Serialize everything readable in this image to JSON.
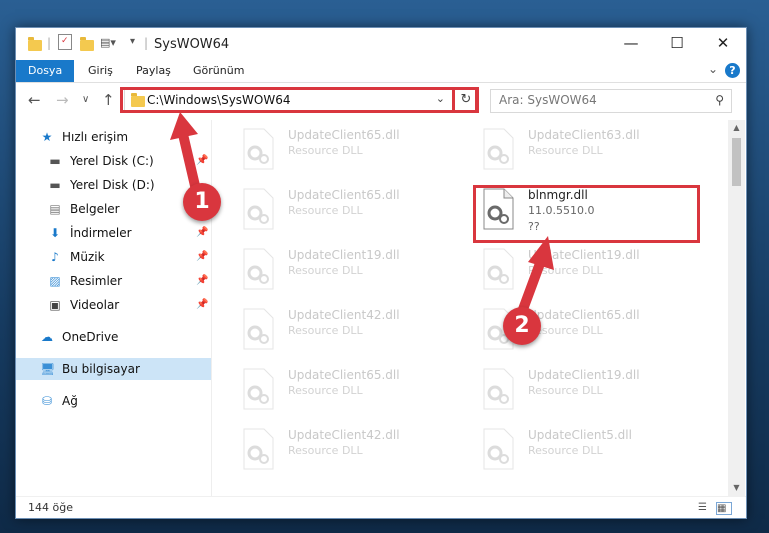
{
  "window": {
    "title": "SysWOW64",
    "controls": {
      "minimize": "—",
      "maximize": "☐",
      "close": "✕"
    }
  },
  "ribbon": {
    "tabs": [
      {
        "label": "Dosya",
        "active": true
      },
      {
        "label": "Giriş",
        "active": false
      },
      {
        "label": "Paylaş",
        "active": false
      },
      {
        "label": "Görünüm",
        "active": false
      }
    ],
    "help": "?"
  },
  "nav": {
    "address": "C:\\Windows\\SysWOW64",
    "search_placeholder": "Ara: SysWOW64"
  },
  "sidebar": {
    "quick_access": "Hızlı erişim",
    "items": [
      {
        "label": "Yerel Disk (C:)",
        "icon": "drive-icon",
        "pinned": true
      },
      {
        "label": "Yerel Disk (D:)",
        "icon": "drive-icon",
        "pinned": true
      },
      {
        "label": "Belgeler",
        "icon": "documents-icon",
        "pinned": true
      },
      {
        "label": "İndirmeler",
        "icon": "downloads-icon",
        "pinned": true
      },
      {
        "label": "Müzik",
        "icon": "music-icon",
        "pinned": true
      },
      {
        "label": "Resimler",
        "icon": "pictures-icon",
        "pinned": true
      },
      {
        "label": "Videolar",
        "icon": "videos-icon",
        "pinned": true
      }
    ],
    "onedrive": "OneDrive",
    "this_pc": "Bu bilgisayar",
    "network": "Ağ"
  },
  "files": {
    "left": [
      {
        "name": "UpdateClient65.dll",
        "desc": "Resource DLL"
      },
      {
        "name": "UpdateClient65.dll",
        "desc": "Resource DLL"
      },
      {
        "name": "UpdateClient19.dll",
        "desc": "Resource DLL"
      },
      {
        "name": "UpdateClient42.dll",
        "desc": "Resource DLL"
      },
      {
        "name": "UpdateClient65.dll",
        "desc": "Resource DLL"
      },
      {
        "name": "UpdateClient42.dll",
        "desc": "Resource DLL"
      }
    ],
    "right": [
      {
        "name": "UpdateClient63.dll",
        "desc": "Resource DLL"
      },
      {
        "name": "UpdateClient19.dll",
        "desc": "Resource DLL"
      },
      {
        "name": "UpdateClient65.dll",
        "desc": "Resource DLL"
      },
      {
        "name": "UpdateClient19.dll",
        "desc": "Resource DLL"
      },
      {
        "name": "UpdateClient5.dll",
        "desc": "Resource DLL"
      }
    ],
    "highlighted": {
      "name": "blnmgr.dll",
      "version": "11.0.5510.0",
      "extra": "??"
    }
  },
  "status": {
    "count": "144 öğe"
  },
  "callouts": {
    "step1": "1",
    "step2": "2"
  },
  "colors": {
    "accent": "#1979ca",
    "highlight": "#d9363e"
  }
}
